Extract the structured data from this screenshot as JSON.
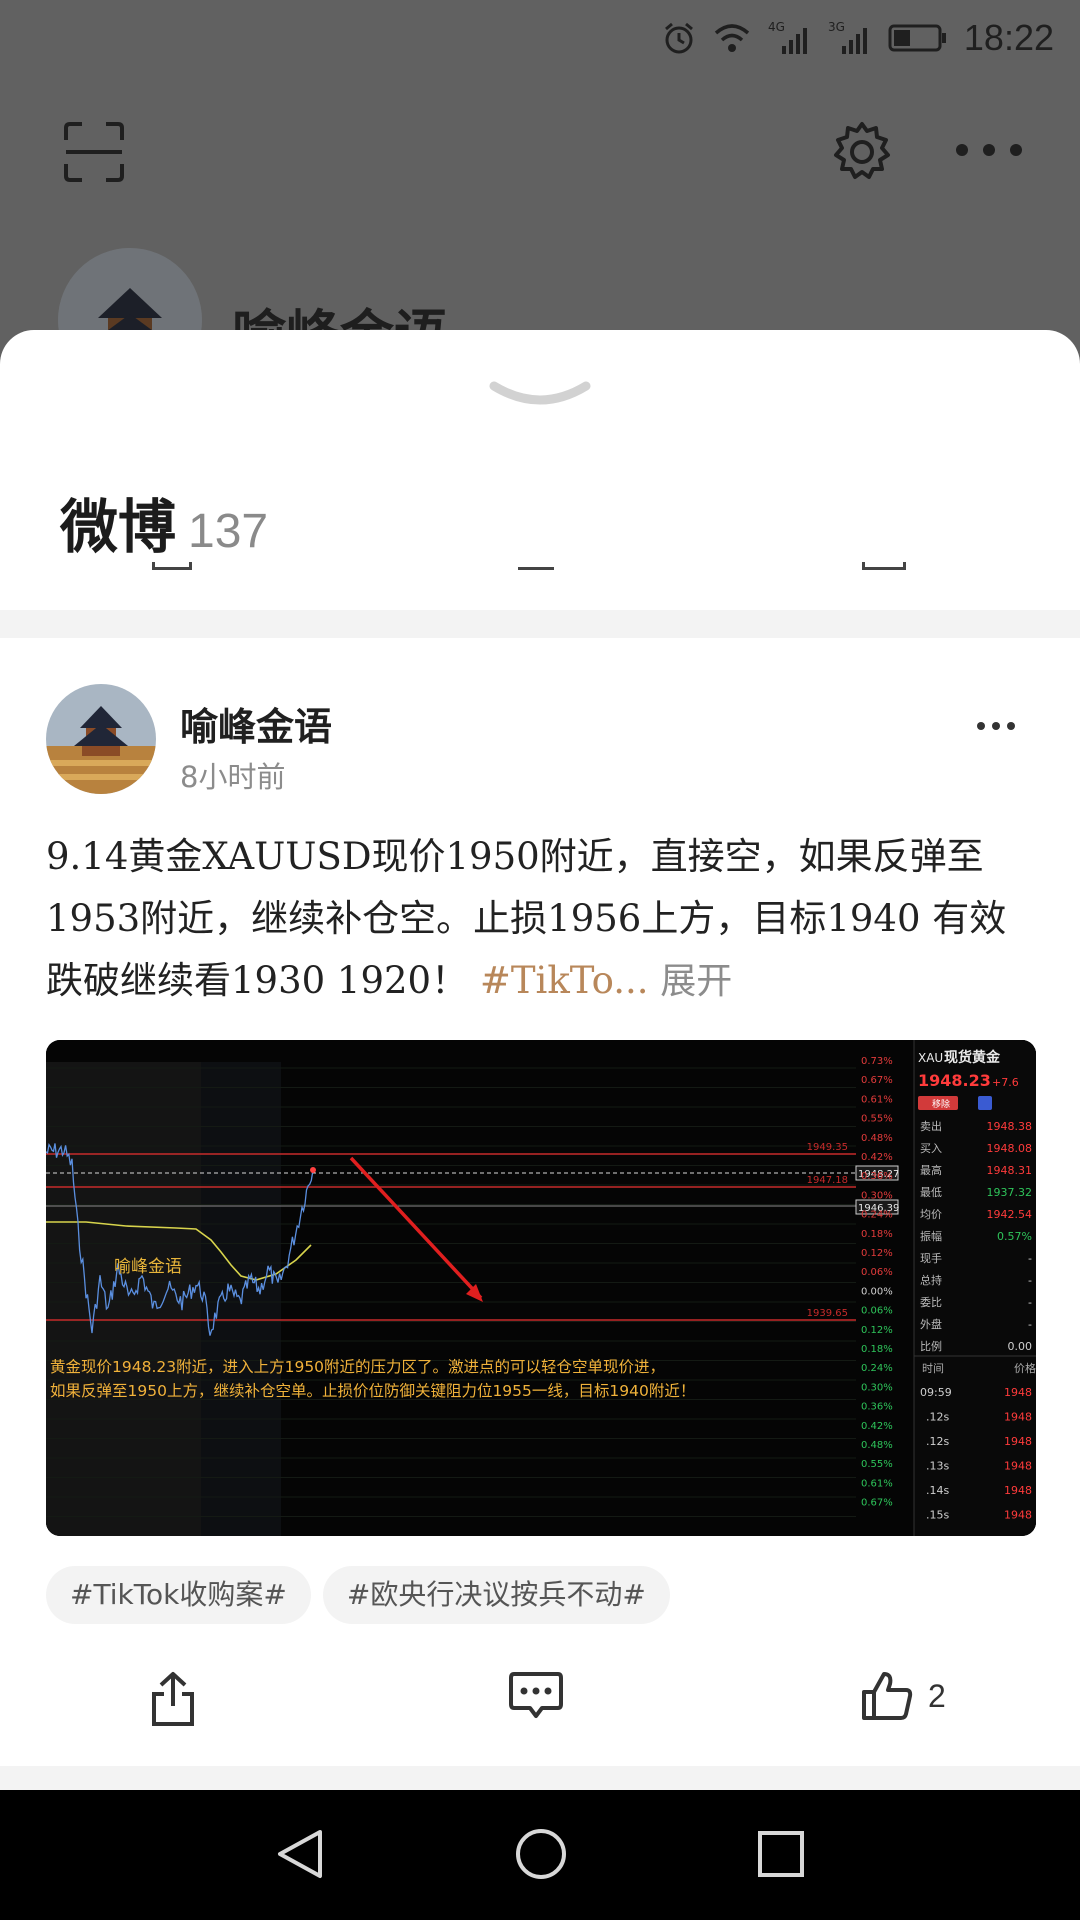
{
  "status_bar": {
    "time": "18:22",
    "net1": "4G",
    "net2": "3G",
    "icons": [
      "alarm-icon",
      "wifi-icon",
      "signal-4g-icon",
      "signal-3g-icon",
      "battery-icon"
    ]
  },
  "background": {
    "profile_name": "喻峰金语",
    "icons": [
      "scan-icon",
      "gear-icon",
      "more-icon"
    ]
  },
  "sheet": {
    "title": "微博",
    "count": "137"
  },
  "post": {
    "author": "喻峰金语",
    "time": "8小时前",
    "text": "9.14黄金XAUUSD现价1950附近，直接空，如果反弹至1953附近，继续补仓空。止损1956上方，目标1940 有效跌破继续看1930 1920！",
    "hashtag_inline": "#TikTo...",
    "expand": "展开",
    "tags": [
      "#TikTok收购案#",
      "#欧央行决议按兵不动#"
    ],
    "like_count": "2"
  },
  "chart_image": {
    "watermark": "喻峰金语",
    "caption_line1": "黄金现价1948.23附近，进入上方1950附近的压力区了。激进点的可以轻仓空单现价进，",
    "caption_line2": "如果反弹至1950上方，继续补仓空单。止损价位防御关键阻力位1955一线，目标1940附近！",
    "level_labels": [
      "1949.35",
      "1947.18",
      "1939.65"
    ],
    "price_tags": [
      "1948.27",
      "1946.39"
    ],
    "percent_ticks": [
      "0.73%",
      "0.67%",
      "0.61%",
      "0.55%",
      "0.48%",
      "0.42%",
      "0.36%",
      "0.30%",
      "0.24%",
      "0.18%",
      "0.12%",
      "0.06%",
      "0.00%",
      "0.06%",
      "0.12%",
      "0.18%",
      "0.24%",
      "0.30%",
      "0.36%",
      "0.42%",
      "0.48%",
      "0.55%",
      "0.61%",
      "0.67%"
    ],
    "quote_panel": {
      "symbol": "XAU",
      "name": "现货黄金",
      "price": "1948.23",
      "change": "+7.6",
      "btn_remove": "移除",
      "rows": [
        {
          "label": "卖出",
          "value": "1948.38"
        },
        {
          "label": "买入",
          "value": "1948.08"
        },
        {
          "label": "最高",
          "value": "1948.31"
        },
        {
          "label": "最低",
          "value": "1937.32"
        },
        {
          "label": "均价",
          "value": "1942.54"
        },
        {
          "label": "振幅",
          "value": "0.57%"
        },
        {
          "label": "现手",
          "value": "-"
        },
        {
          "label": "总持",
          "value": "-"
        },
        {
          "label": "委比",
          "value": "-"
        },
        {
          "label": "外盘",
          "value": "-"
        },
        {
          "label": "比例",
          "value": "0.00"
        }
      ],
      "tick_header_time": "时间",
      "tick_header_price": "价格",
      "ticks": [
        {
          "t": "09:59",
          "p": "1948"
        },
        {
          "t": ".12s",
          "p": "1948"
        },
        {
          "t": ".12s",
          "p": "1948"
        },
        {
          "t": ".13s",
          "p": "1948"
        },
        {
          "t": ".14s",
          "p": "1948"
        },
        {
          "t": ".15s",
          "p": "1948"
        }
      ]
    }
  },
  "nav": {
    "icons": [
      "back-icon",
      "home-icon",
      "recents-icon"
    ]
  },
  "colors": {
    "hashtag": "#b8875a",
    "chart_bg": "#050505",
    "up_red": "#e23b3b",
    "down_green": "#2ec45a",
    "caption": "#f0b23a"
  }
}
